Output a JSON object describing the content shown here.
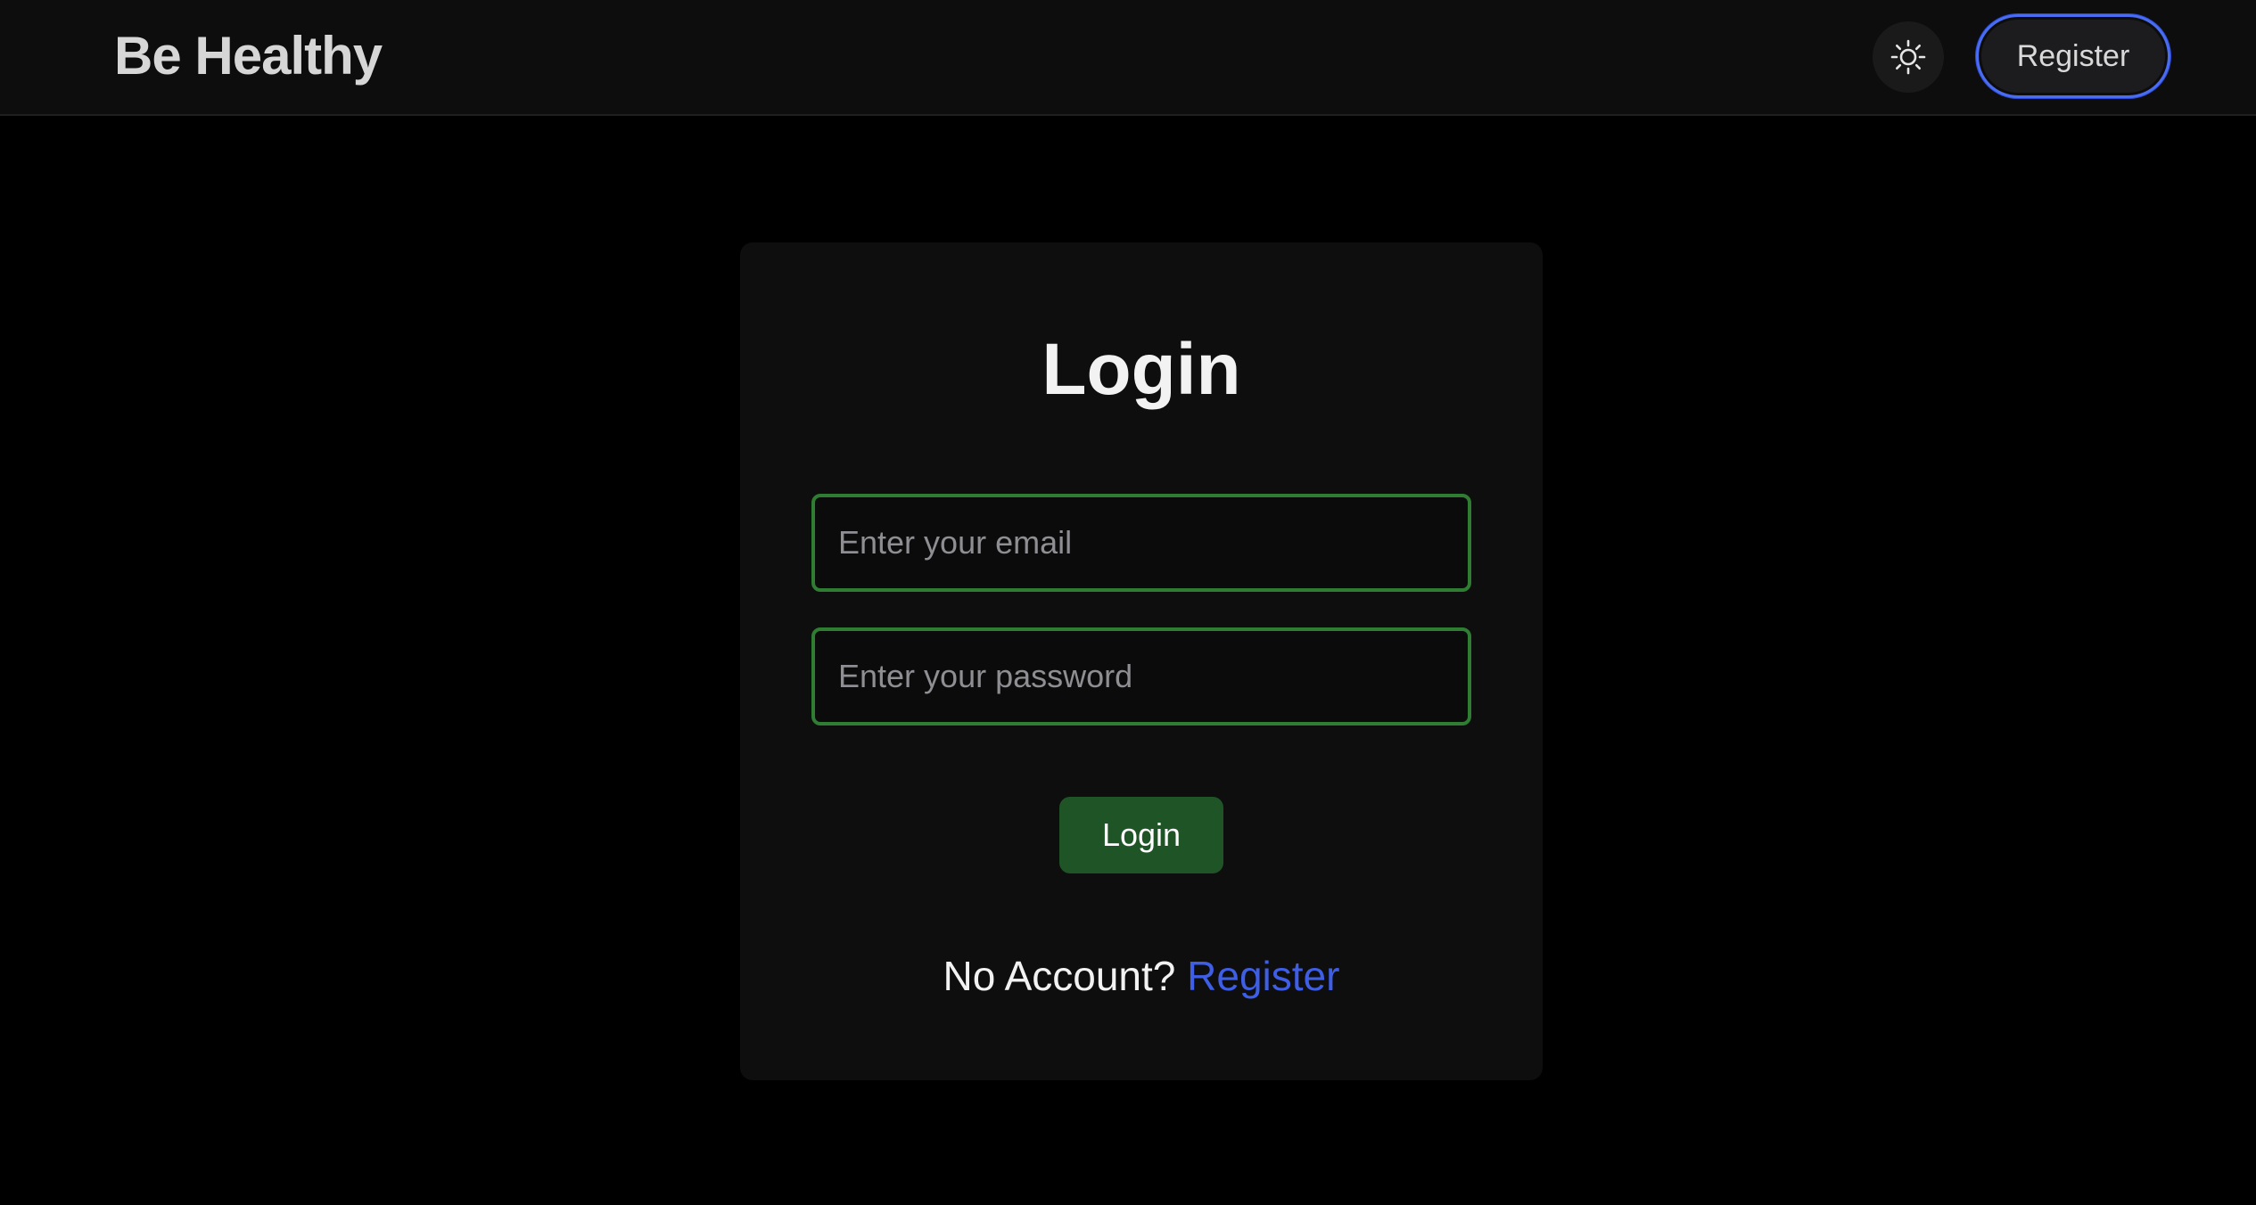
{
  "header": {
    "brand": "Be Healthy",
    "theme_toggle_icon": "sun-icon",
    "register_label": "Register"
  },
  "login_card": {
    "title": "Login",
    "email_placeholder": "Enter your email",
    "password_placeholder": "Enter your password",
    "login_button_label": "Login",
    "no_account_text": "No Account?",
    "register_link_label": "Register"
  },
  "colors": {
    "page_background": "#000000",
    "card_background": "#0e0e0e",
    "input_border": "#2e7d32",
    "login_button": "#1f5526",
    "register_link": "#3f5ee6",
    "nav_register_border": "#4a6cf0"
  }
}
